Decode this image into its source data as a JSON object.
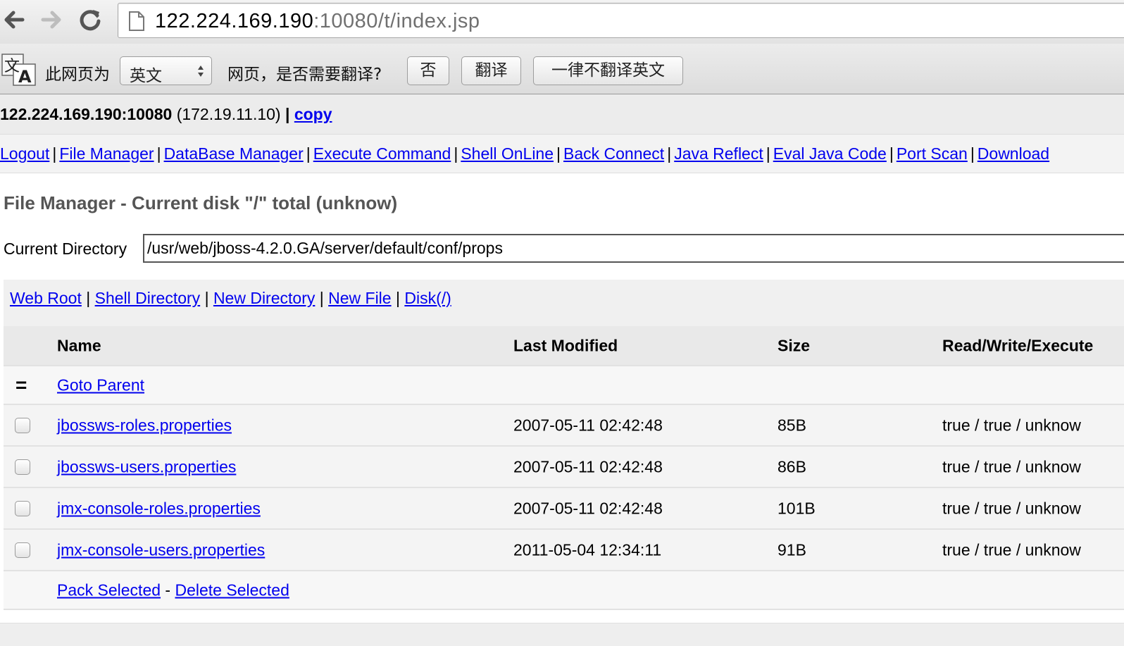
{
  "browser": {
    "url_host": "122.224.169.190",
    "url_rest": ":10080/t/index.jsp"
  },
  "translate_bar": {
    "prefix": "此网页为",
    "language": "英文",
    "question": "网页，是否需要翻译?",
    "no_button": "否",
    "translate_button": "翻译",
    "never_button": "一律不翻译英文",
    "icon_char_1": "文",
    "icon_char_2": "A"
  },
  "host": {
    "address": "122.224.169.190:10080",
    "internal_ip": "(172.19.11.10)",
    "separator": "|",
    "copy_label": "copy"
  },
  "menu": {
    "items": [
      "Logout",
      "File Manager",
      "DataBase Manager",
      "Execute Command",
      "Shell OnLine",
      "Back Connect",
      "Java Reflect",
      "Eval Java Code",
      "Port Scan",
      "Download"
    ],
    "separator": "|"
  },
  "file_manager": {
    "title": "File Manager - Current disk \"/\" total (unknow)",
    "current_dir_label": "Current Directory",
    "current_dir_value": "/usr/web/jboss-4.2.0.GA/server/default/conf/props",
    "quick_links": [
      "Web Root",
      "Shell Directory",
      "New Directory",
      "New File",
      "Disk(/)"
    ],
    "columns": {
      "name": "Name",
      "modified": "Last Modified",
      "size": "Size",
      "rwe": "Read/Write/Execute"
    },
    "parent": {
      "mark": "=",
      "label": "Goto Parent"
    },
    "files": [
      {
        "name": "jbossws-roles.properties",
        "modified": "2007-05-11 02:42:48",
        "size": "85B",
        "rwe": "true / true / unknow"
      },
      {
        "name": "jbossws-users.properties",
        "modified": "2007-05-11 02:42:48",
        "size": "86B",
        "rwe": "true / true / unknow"
      },
      {
        "name": "jmx-console-roles.properties",
        "modified": "2007-05-11 02:42:48",
        "size": "101B",
        "rwe": "true / true / unknow"
      },
      {
        "name": "jmx-console-users.properties",
        "modified": "2011-05-04 12:34:11",
        "size": "91B",
        "rwe": "true / true / unknow"
      }
    ],
    "footer": {
      "pack_label": "Pack Selected",
      "dash": "-",
      "delete_label": "Delete Selected"
    }
  }
}
